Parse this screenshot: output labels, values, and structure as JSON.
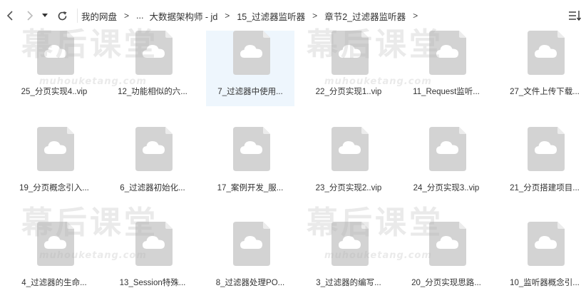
{
  "nav": {
    "back": "back-icon",
    "forward": "forward-icon",
    "history": "dropdown-icon",
    "refresh": "refresh-icon"
  },
  "breadcrumb": [
    "我的网盘",
    "...",
    "大数据架构师 - jd",
    "15_过滤器监听器",
    "章节2_过滤器监听器"
  ],
  "breadcrumb_sep": ">",
  "view_toggle": "sort-icon",
  "watermark": {
    "text": "幕后课堂",
    "url": "muhouketang.com"
  },
  "files": [
    "25_分页实现4..vip",
    "12_功能相似的六...",
    "7_过滤器中使用...",
    "22_分页实现1..vip",
    "11_Request监听...",
    "27_文件上传下载...",
    "19_分页概念引入...",
    "6_过滤器初始化...",
    "17_案例开发_服...",
    "23_分页实现2..vip",
    "24_分页实现3..vip",
    "21_分页搭建项目...",
    "4_过滤器的生命...",
    "13_Session特殊...",
    "8_过滤器处理PO...",
    "3_过滤器的编写...",
    "20_分页实现思路...",
    "10_监听器概念引..."
  ],
  "selected_index": 2
}
